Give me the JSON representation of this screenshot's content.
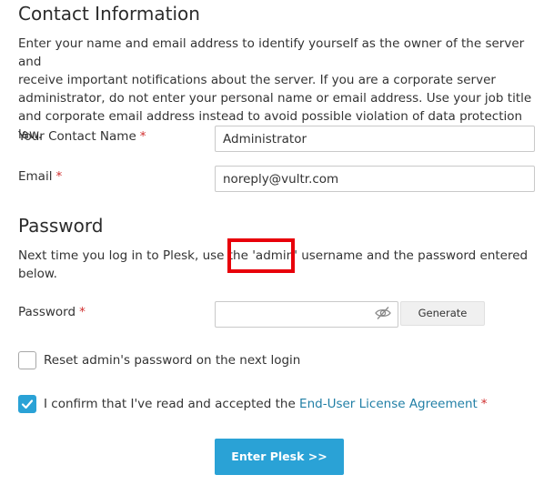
{
  "contact": {
    "title": "Contact Information",
    "description_lines": [
      "Enter your name and email address to identify yourself as the owner of the server and",
      "receive important notifications about the server. If you are a corporate server",
      "administrator, do not enter your personal name or email address. Use your job title",
      "and corporate email address instead to avoid possible violation of data protection law."
    ],
    "name_label": "Your Contact Name",
    "name_value": "Administrator",
    "email_label": "Email",
    "email_value": "noreply@vultr.com",
    "required_mark": "*"
  },
  "password": {
    "title": "Password",
    "description_line1": "Next time you log in to Plesk, use the 'admin' username and the password entered",
    "description_line2": "below.",
    "field_label": "Password",
    "field_value": "",
    "eye_icon": "eye-slash-icon",
    "generate_label": "Generate",
    "required_mark": "*"
  },
  "options": {
    "reset_label": "Reset admin's password on the next login",
    "reset_checked": false,
    "eula_prefix": "I confirm that I've read and accepted the ",
    "eula_link": "End-User License Agreement",
    "eula_checked": true,
    "required_mark": "*"
  },
  "submit": {
    "label": "Enter Plesk >>"
  },
  "colors": {
    "accent": "#2aa2d6",
    "link": "#217fa6",
    "required": "#d02d2d",
    "annotation": "#e8000a"
  }
}
